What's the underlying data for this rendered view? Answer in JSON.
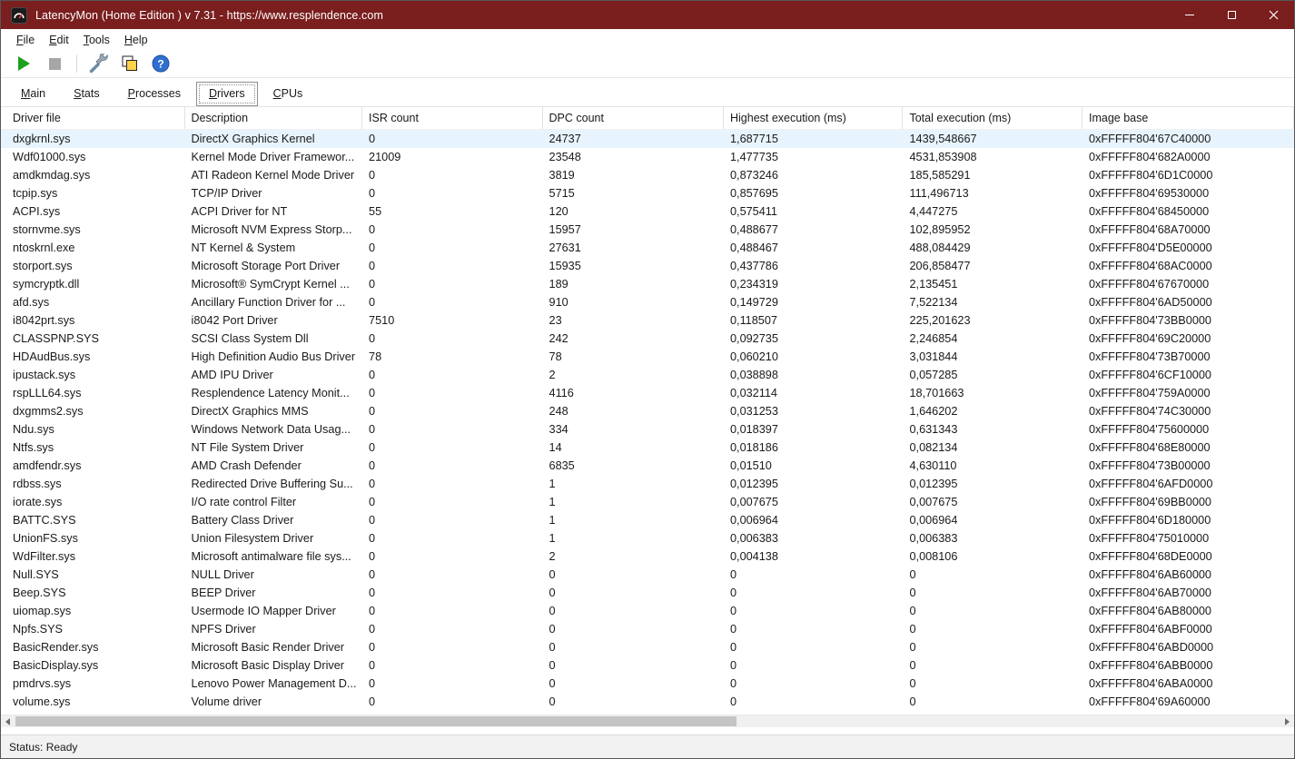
{
  "window": {
    "title": "LatencyMon  (Home Edition )  v 7.31 - https://www.resplendence.com"
  },
  "menubar": {
    "items": [
      "File",
      "Edit",
      "Tools",
      "Help"
    ]
  },
  "toolbar": {
    "buttons": [
      {
        "name": "start-monitor",
        "icon": "play-icon",
        "enabled": true
      },
      {
        "name": "stop-monitor",
        "icon": "stop-icon",
        "enabled": false
      },
      {
        "name": "options-tools",
        "icon": "tools-icon",
        "enabled": true
      },
      {
        "name": "copy-report",
        "icon": "copy-icon",
        "enabled": true
      },
      {
        "name": "help",
        "icon": "help-icon",
        "enabled": true
      }
    ]
  },
  "tabs": {
    "items": [
      "Main",
      "Stats",
      "Processes",
      "Drivers",
      "CPUs"
    ],
    "selected": "Drivers"
  },
  "table": {
    "columns": [
      "Driver file",
      "Description",
      "ISR count",
      "DPC count",
      "Highest execution (ms)",
      "Total execution (ms)",
      "Image base"
    ],
    "selected_index": 0,
    "rows": [
      [
        "dxgkrnl.sys",
        "DirectX Graphics Kernel",
        "0",
        "24737",
        "1,687715",
        "1439,548667",
        "0xFFFFF804'67C40000"
      ],
      [
        "Wdf01000.sys",
        "Kernel Mode Driver Framewor...",
        "21009",
        "23548",
        "1,477735",
        "4531,853908",
        "0xFFFFF804'682A0000"
      ],
      [
        "amdkmdag.sys",
        "ATI Radeon Kernel Mode Driver",
        "0",
        "3819",
        "0,873246",
        "185,585291",
        "0xFFFFF804'6D1C0000"
      ],
      [
        "tcpip.sys",
        "TCP/IP Driver",
        "0",
        "5715",
        "0,857695",
        "111,496713",
        "0xFFFFF804'69530000"
      ],
      [
        "ACPI.sys",
        "ACPI Driver for NT",
        "55",
        "120",
        "0,575411",
        "4,447275",
        "0xFFFFF804'68450000"
      ],
      [
        "stornvme.sys",
        "Microsoft NVM Express Storp...",
        "0",
        "15957",
        "0,488677",
        "102,895952",
        "0xFFFFF804'68A70000"
      ],
      [
        "ntoskrnl.exe",
        "NT Kernel & System",
        "0",
        "27631",
        "0,488467",
        "488,084429",
        "0xFFFFF804'D5E00000"
      ],
      [
        "storport.sys",
        "Microsoft Storage Port Driver",
        "0",
        "15935",
        "0,437786",
        "206,858477",
        "0xFFFFF804'68AC0000"
      ],
      [
        "symcryptk.dll",
        "Microsoft® SymCrypt Kernel ...",
        "0",
        "189",
        "0,234319",
        "2,135451",
        "0xFFFFF804'67670000"
      ],
      [
        "afd.sys",
        "Ancillary Function Driver for ...",
        "0",
        "910",
        "0,149729",
        "7,522134",
        "0xFFFFF804'6AD50000"
      ],
      [
        "i8042prt.sys",
        "i8042 Port Driver",
        "7510",
        "23",
        "0,118507",
        "225,201623",
        "0xFFFFF804'73BB0000"
      ],
      [
        "CLASSPNP.SYS",
        "SCSI Class System Dll",
        "0",
        "242",
        "0,092735",
        "2,246854",
        "0xFFFFF804'69C20000"
      ],
      [
        "HDAudBus.sys",
        "High Definition Audio Bus Driver",
        "78",
        "78",
        "0,060210",
        "3,031844",
        "0xFFFFF804'73B70000"
      ],
      [
        "ipustack.sys",
        "AMD IPU Driver",
        "0",
        "2",
        "0,038898",
        "0,057285",
        "0xFFFFF804'6CF10000"
      ],
      [
        "rspLLL64.sys",
        "Resplendence Latency Monit...",
        "0",
        "4116",
        "0,032114",
        "18,701663",
        "0xFFFFF804'759A0000"
      ],
      [
        "dxgmms2.sys",
        "DirectX Graphics MMS",
        "0",
        "248",
        "0,031253",
        "1,646202",
        "0xFFFFF804'74C30000"
      ],
      [
        "Ndu.sys",
        "Windows Network Data Usag...",
        "0",
        "334",
        "0,018397",
        "0,631343",
        "0xFFFFF804'75600000"
      ],
      [
        "Ntfs.sys",
        "NT File System Driver",
        "0",
        "14",
        "0,018186",
        "0,082134",
        "0xFFFFF804'68E80000"
      ],
      [
        "amdfendr.sys",
        "AMD Crash Defender",
        "0",
        "6835",
        "0,01510",
        "4,630110",
        "0xFFFFF804'73B00000"
      ],
      [
        "rdbss.sys",
        "Redirected Drive Buffering Su...",
        "0",
        "1",
        "0,012395",
        "0,012395",
        "0xFFFFF804'6AFD0000"
      ],
      [
        "iorate.sys",
        "I/O rate control Filter",
        "0",
        "1",
        "0,007675",
        "0,007675",
        "0xFFFFF804'69BB0000"
      ],
      [
        "BATTC.SYS",
        "Battery Class Driver",
        "0",
        "1",
        "0,006964",
        "0,006964",
        "0xFFFFF804'6D180000"
      ],
      [
        "UnionFS.sys",
        "Union Filesystem Driver",
        "0",
        "1",
        "0,006383",
        "0,006383",
        "0xFFFFF804'75010000"
      ],
      [
        "WdFilter.sys",
        "Microsoft antimalware file sys...",
        "0",
        "2",
        "0,004138",
        "0,008106",
        "0xFFFFF804'68DE0000"
      ],
      [
        "Null.SYS",
        "NULL Driver",
        "0",
        "0",
        "0",
        "0",
        "0xFFFFF804'6AB60000"
      ],
      [
        "Beep.SYS",
        "BEEP Driver",
        "0",
        "0",
        "0",
        "0",
        "0xFFFFF804'6AB70000"
      ],
      [
        "uiomap.sys",
        "Usermode IO Mapper Driver",
        "0",
        "0",
        "0",
        "0",
        "0xFFFFF804'6AB80000"
      ],
      [
        "Npfs.SYS",
        "NPFS Driver",
        "0",
        "0",
        "0",
        "0",
        "0xFFFFF804'6ABF0000"
      ],
      [
        "BasicRender.sys",
        "Microsoft Basic Render Driver",
        "0",
        "0",
        "0",
        "0",
        "0xFFFFF804'6ABD0000"
      ],
      [
        "BasicDisplay.sys",
        "Microsoft Basic Display Driver",
        "0",
        "0",
        "0",
        "0",
        "0xFFFFF804'6ABB0000"
      ],
      [
        "pmdrvs.sys",
        "Lenovo Power Management D...",
        "0",
        "0",
        "0",
        "0",
        "0xFFFFF804'6ABA0000"
      ],
      [
        "volume.sys",
        "Volume driver",
        "0",
        "0",
        "0",
        "0",
        "0xFFFFF804'69A60000"
      ]
    ]
  },
  "statusbar": {
    "text": "Status: Ready"
  },
  "colors": {
    "titlebar": "#7a1e1e",
    "selection": "#e8f4fd",
    "play_green": "#1ea01e",
    "help_blue": "#2f6fd0",
    "copy_yellow": "#ffd24a"
  },
  "icons": {
    "app": "latencymon-gauge-icon",
    "minimize": "minimize-icon",
    "maximize": "maximize-icon",
    "close": "close-icon",
    "start": "play-icon",
    "stop": "stop-icon",
    "options": "tools-icon",
    "copy": "copy-icon",
    "help": "help-icon",
    "scroll_left": "scroll-left-arrow-icon",
    "scroll_right": "scroll-right-arrow-icon"
  }
}
